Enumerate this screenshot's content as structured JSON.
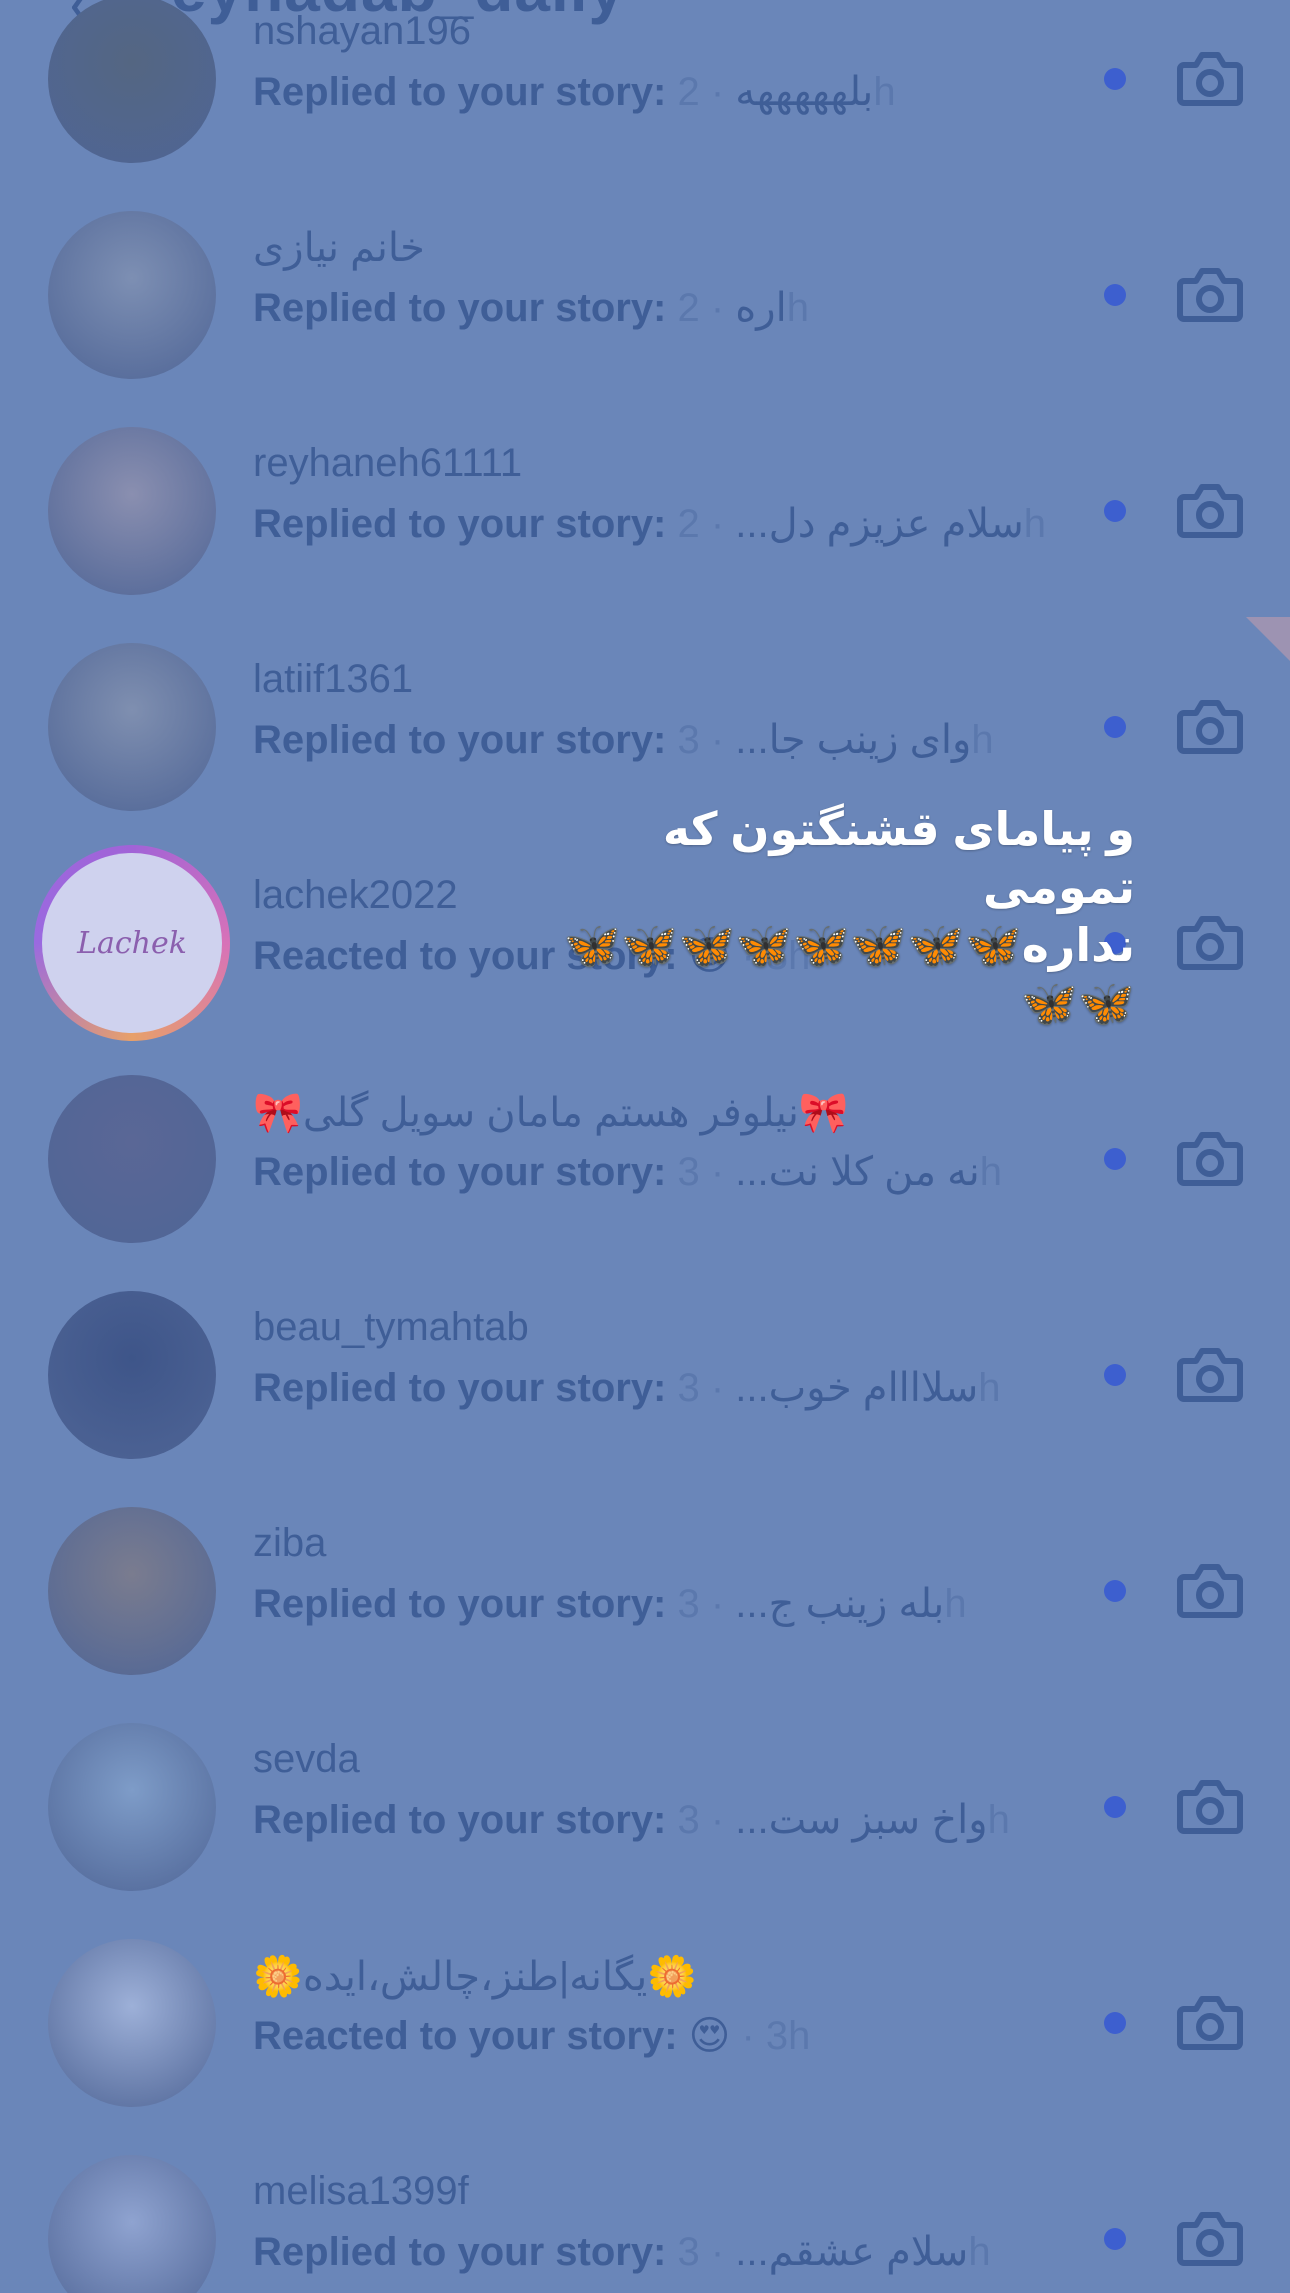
{
  "header": {
    "title": "zeynadab_daily",
    "back_icon": "chevron-left-icon",
    "camera_icon": "camera-icon"
  },
  "rows": [
    {
      "name": "nshayan196",
      "label": "Replied to your story: ",
      "snippet": "بلهههههه",
      "time": " · 2h",
      "avatar_color": "#546682"
    },
    {
      "name": "خانم نیازی",
      "label": "Replied to your story: ",
      "snippet": "اره",
      "time": " · 2h",
      "avatar_color": "#7d8fb3"
    },
    {
      "name": "reyhaneh61111",
      "label": "Replied to your story: ",
      "snippet": "سلام عزیزم دل...",
      "time": " · 2h",
      "avatar_color": "#8a8fb0"
    },
    {
      "name": "latiif1361",
      "label": "Replied to your story: ",
      "snippet": "وای زینب جا...",
      "time": " · 3h",
      "avatar_color": "#7f8fb0"
    },
    {
      "name": "lachek2022",
      "label": "Reacted to your story: ",
      "snippet": "😍",
      "time": " · 3h",
      "avatar_color": "#cfd2ee",
      "logo": "Lachek"
    },
    {
      "name": "🎀نیلوفر هستم مامان سویل گلی🎀",
      "label": "Replied to your story: ",
      "snippet": "نه من کلا نت...",
      "time": " · 3h",
      "avatar_color": "#5a6796"
    },
    {
      "name": "beau_tymahtab",
      "label": "Replied to your story: ",
      "snippet": "سلاااام خوب...",
      "time": " · 3h",
      "avatar_color": "#3e5589"
    },
    {
      "name": "ziba",
      "label": "Replied to your story: ",
      "snippet": "بله زینب ج...",
      "time": " · 3h",
      "avatar_color": "#7a7c8f"
    },
    {
      "name": "sevda",
      "label": "Replied to your story: ",
      "snippet": "واخ سبز ست...",
      "time": " · 3h",
      "avatar_color": "#7e9cc8"
    },
    {
      "name": "🌼یگانه|طنز،چالش،ایده🌼",
      "label": "Reacted to your story: ",
      "snippet": "😍",
      "time": " · 3h",
      "avatar_color": "#9db0d8"
    },
    {
      "name": "melisa1399f",
      "label": "Replied to your story: ",
      "snippet": "سلام عشقم...",
      "time": " · 3h",
      "avatar_color": "#8fa3d0"
    }
  ],
  "overlay": {
    "line1": "و پیامای قشنگتون که تمومی",
    "line2": "نداره",
    "butterflies": "🦋🦋🦋🦋🦋🦋🦋🦋🦋🦋"
  }
}
